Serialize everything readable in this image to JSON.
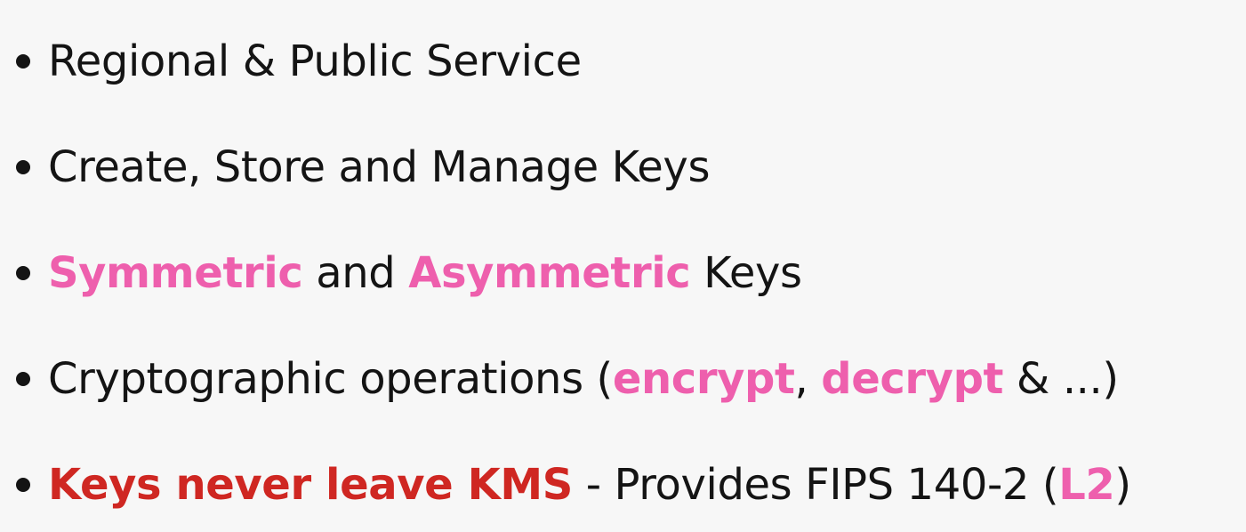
{
  "colors": {
    "background": "#f7f7f7",
    "text": "#141414",
    "pink_highlight": "#ee5fad",
    "red_highlight": "#cf2722"
  },
  "bullets": [
    {
      "text": "Regional & Public Service"
    },
    {
      "text": "Create, Store and Manage Keys"
    },
    {
      "highlight_1": "Symmetric",
      "middle": " and ",
      "highlight_2": "Asymmetric",
      "suffix": " Keys"
    },
    {
      "prefix": "Cryptographic operations (",
      "highlight_1": "encrypt",
      "middle": ", ",
      "highlight_2": "decrypt",
      "suffix": " & ...)"
    },
    {
      "highlight_red": "Keys never leave KMS",
      "middle": " - Provides FIPS 140-2 (",
      "highlight_pink": "L2",
      "suffix": ")"
    }
  ]
}
